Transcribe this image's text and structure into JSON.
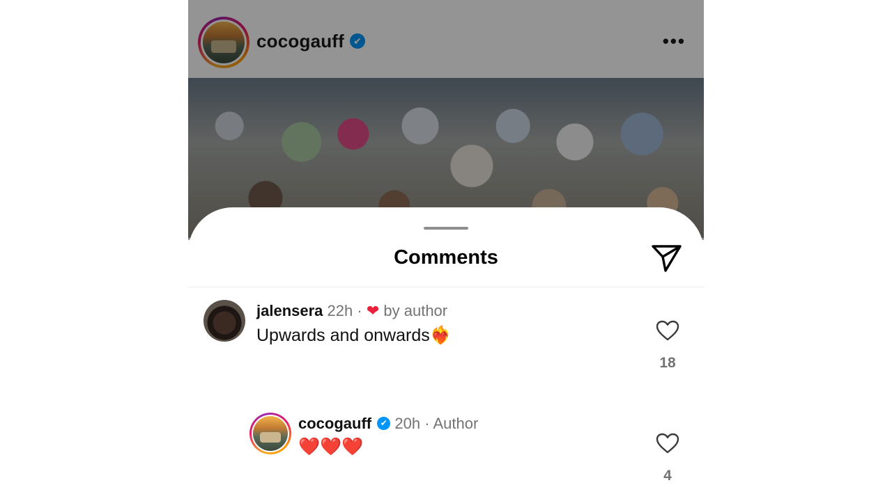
{
  "post": {
    "username": "cocogauff",
    "verified_glyph": "✔",
    "more_glyph": "•••"
  },
  "sheet": {
    "title": "Comments",
    "share_icon": "send-icon"
  },
  "comments": [
    {
      "username": "jalensera",
      "time": "22h",
      "separator": "·",
      "liked_by_author_glyph": "❤",
      "liked_by_author_text": "by author",
      "text": "Upwards and onwards❤️‍🔥",
      "likes": "18"
    },
    {
      "username": "cocogauff",
      "verified_glyph": "✔",
      "time": "20h",
      "separator": "·",
      "role": "Author",
      "text": "❤️❤️❤️",
      "likes": "4"
    }
  ],
  "colors": {
    "verified": "#0095f6",
    "heart": "#ed1f3a",
    "meta": "#737373"
  }
}
